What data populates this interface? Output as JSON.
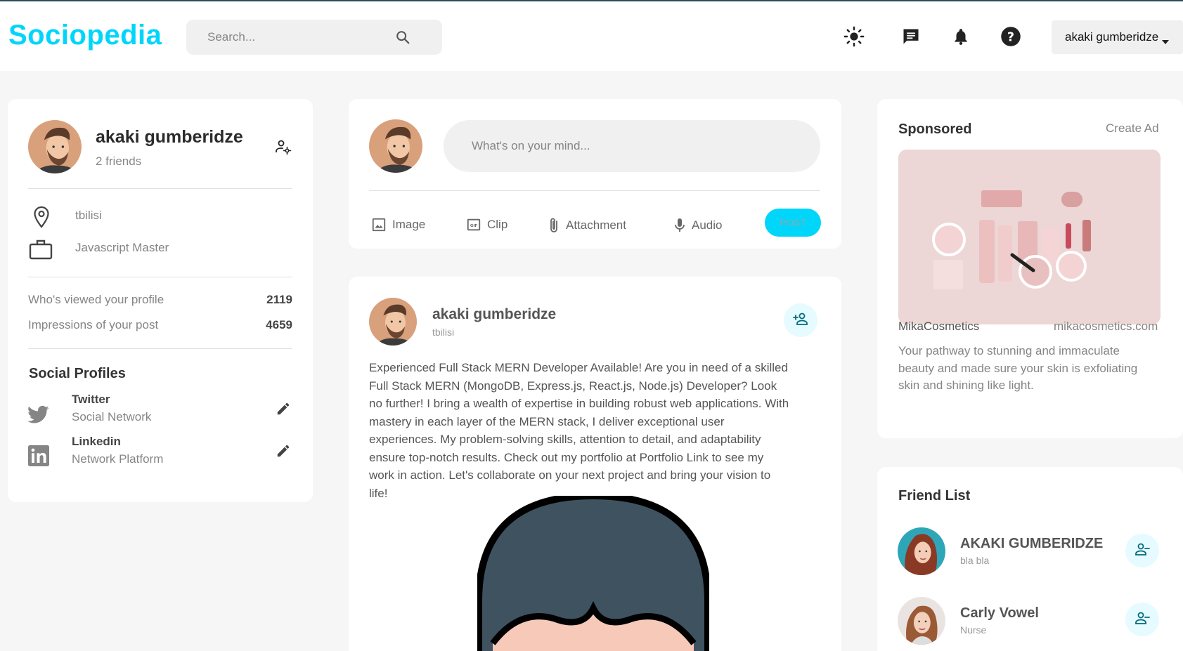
{
  "navbar": {
    "logo": "Sociopedia",
    "search_placeholder": "Search...",
    "user_name": "akaki gumberidze"
  },
  "user_widget": {
    "name": "akaki gumberidze",
    "friends": "2 friends",
    "location": "tbilisi",
    "occupation": "Javascript Master",
    "stats": [
      {
        "label": "Who's viewed your profile",
        "value": "2119"
      },
      {
        "label": "Impressions of your post",
        "value": "4659"
      }
    ],
    "social_title": "Social Profiles",
    "socials": [
      {
        "name": "Twitter",
        "sub": "Social Network"
      },
      {
        "name": "Linkedin",
        "sub": "Network Platform"
      }
    ]
  },
  "post_widget": {
    "placeholder": "What's on your mind...",
    "actions": [
      "Image",
      "Clip",
      "Attachment",
      "Audio"
    ],
    "post_label": "POST"
  },
  "feed_post": {
    "name": "akaki gumberidze",
    "location": "tbilisi",
    "text": "Experienced Full Stack MERN Developer Available! Are you in need of a skilled Full Stack MERN (MongoDB, Express.js, React.js, Node.js) Developer? Look no further! I bring a wealth of expertise in building robust web applications. With mastery in each layer of the MERN stack, I deliver exceptional user experiences. My problem-solving skills, attention to detail, and adaptability ensure top-notch results. Check out my portfolio at Portfolio Link to see my work in action. Let's collaborate on your next project and bring your vision to life!"
  },
  "ad_widget": {
    "title": "Sponsored",
    "create": "Create Ad",
    "brand": "MikaCosmetics",
    "site": "mikacosmetics.com",
    "description": "Your pathway to stunning and immaculate beauty and made sure your skin is exfoliating skin and shining like light."
  },
  "friend_list": {
    "title": "Friend List",
    "friends": [
      {
        "name": "AKAKI GUMBERIDZE",
        "sub": "bla bla"
      },
      {
        "name": "Carly Vowel",
        "sub": "Nurse"
      }
    ]
  },
  "colors": {
    "primary": "#00d5fa",
    "primary_light": "#e6fbff",
    "background": "#f6f6f6",
    "card": "#ffffff",
    "neutral": "#858585"
  }
}
